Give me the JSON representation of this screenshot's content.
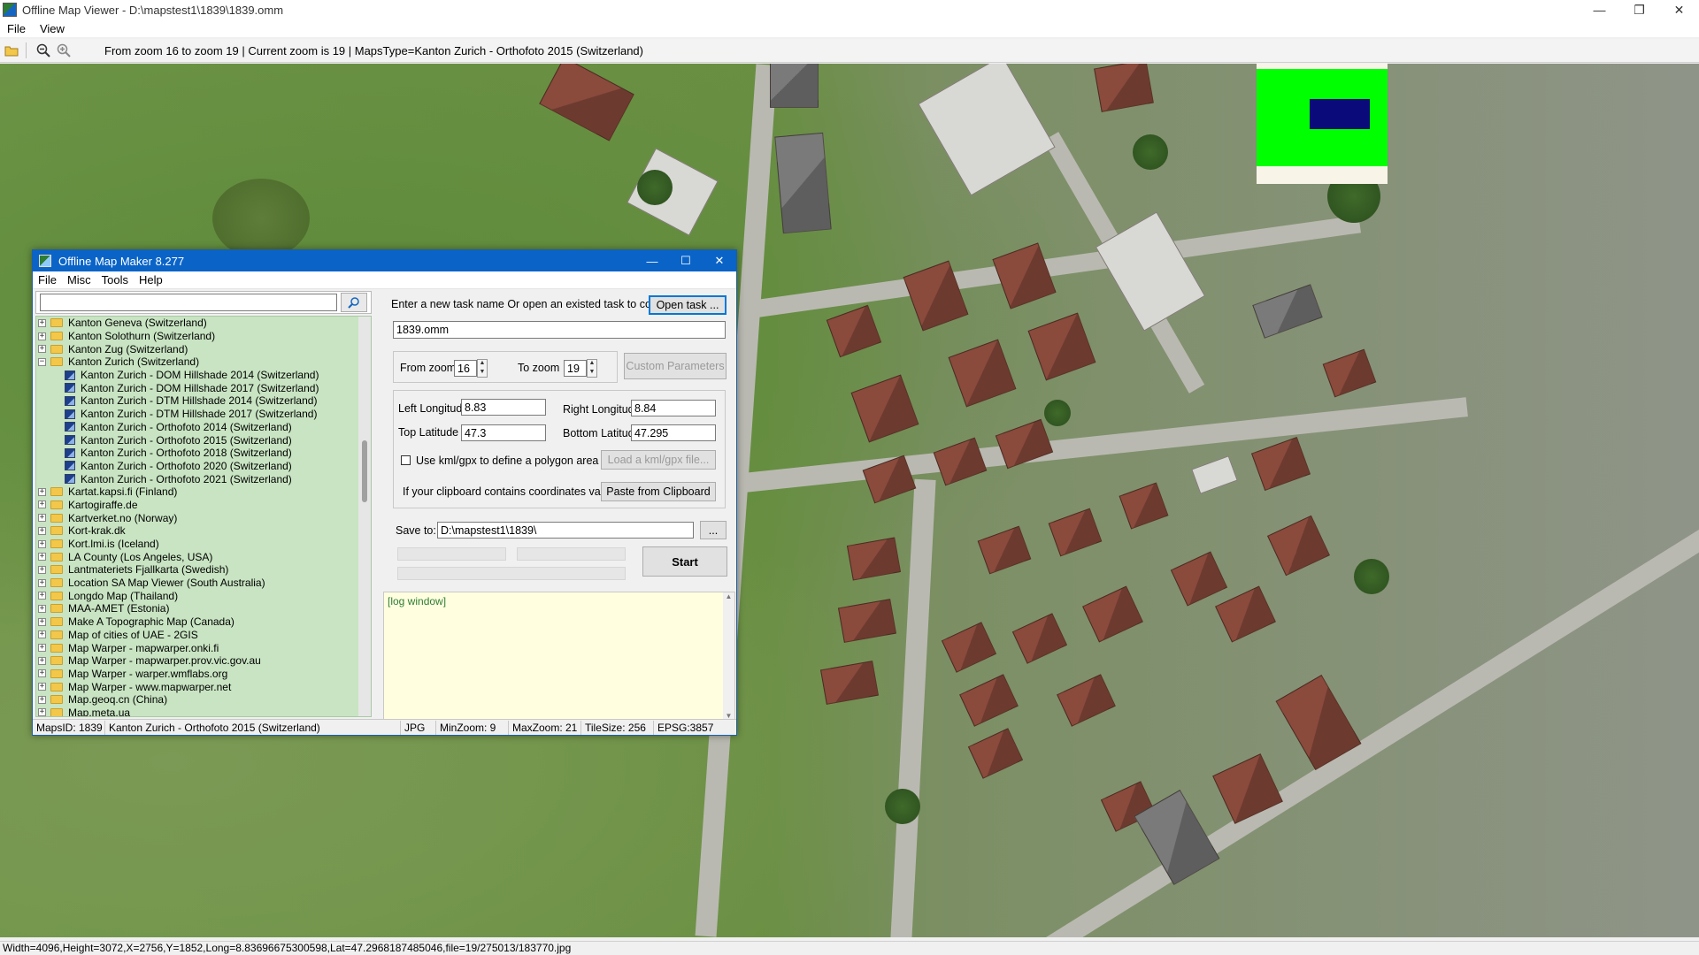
{
  "window": {
    "title": "Offline Map Viewer - D:\\mapstest1\\1839\\1839.omm",
    "controls": [
      "—",
      "❐",
      "✕"
    ]
  },
  "menu": [
    "File",
    "View"
  ],
  "toolbar": {
    "info": "From zoom 16 to zoom 19   |   Current zoom is 19 |   MapsType=Kanton Zurich - Orthofoto 2015 (Switzerland)"
  },
  "status_line": "Width=4096,Height=3072,X=2756,Y=1852,Long=8.83696675300598,Lat=47.2968187485046,file=19/275013/183770.jpg",
  "dialog": {
    "title": "Offline Map Maker 8.277",
    "controls": [
      "—",
      "☐",
      "✕"
    ],
    "menu": [
      "File",
      "Misc",
      "Tools",
      "Help"
    ],
    "search": {
      "value": ""
    },
    "tree": [
      {
        "label": "Kanton Geneva (Switzerland)",
        "type": "folder",
        "exp": "+"
      },
      {
        "label": "Kanton Solothurn (Switzerland)",
        "type": "folder",
        "exp": "+"
      },
      {
        "label": "Kanton Zug (Switzerland)",
        "type": "folder",
        "exp": "+"
      },
      {
        "label": "Kanton Zurich (Switzerland)",
        "type": "folder",
        "exp": "−"
      },
      {
        "label": "Kanton Zurich - DOM Hillshade 2014 (Switzerland)",
        "type": "map"
      },
      {
        "label": "Kanton Zurich - DOM Hillshade 2017 (Switzerland)",
        "type": "map"
      },
      {
        "label": "Kanton Zurich - DTM Hillshade 2014 (Switzerland)",
        "type": "map"
      },
      {
        "label": "Kanton Zurich - DTM Hillshade 2017 (Switzerland)",
        "type": "map"
      },
      {
        "label": "Kanton Zurich - Orthofoto 2014 (Switzerland)",
        "type": "map"
      },
      {
        "label": "Kanton Zurich - Orthofoto 2015 (Switzerland)",
        "type": "map"
      },
      {
        "label": "Kanton Zurich - Orthofoto 2018 (Switzerland)",
        "type": "map"
      },
      {
        "label": "Kanton Zurich - Orthofoto 2020 (Switzerland)",
        "type": "map"
      },
      {
        "label": "Kanton Zurich - Orthofoto 2021 (Switzerland)",
        "type": "map"
      },
      {
        "label": "Kartat.kapsi.fi (Finland)",
        "type": "folder",
        "exp": "+"
      },
      {
        "label": "Kartogiraffe.de",
        "type": "folder",
        "exp": "+"
      },
      {
        "label": "Kartverket.no (Norway)",
        "type": "folder",
        "exp": "+"
      },
      {
        "label": "Kort-krak.dk",
        "type": "folder",
        "exp": "+"
      },
      {
        "label": "Kort.lmi.is (Iceland)",
        "type": "folder",
        "exp": "+"
      },
      {
        "label": "LA County (Los Angeles, USA)",
        "type": "folder",
        "exp": "+"
      },
      {
        "label": "Lantmateriets Fjallkarta (Swedish)",
        "type": "folder",
        "exp": "+"
      },
      {
        "label": "Location SA Map Viewer (South Australia)",
        "type": "folder",
        "exp": "+"
      },
      {
        "label": "Longdo Map (Thailand)",
        "type": "folder",
        "exp": "+"
      },
      {
        "label": "MAA-AMET (Estonia)",
        "type": "folder",
        "exp": "+"
      },
      {
        "label": "Make A Topographic Map (Canada)",
        "type": "folder",
        "exp": "+"
      },
      {
        "label": "Map of cities of UAE - 2GIS",
        "type": "folder",
        "exp": "+"
      },
      {
        "label": "Map Warper - mapwarper.onki.fi",
        "type": "folder",
        "exp": "+"
      },
      {
        "label": "Map Warper - mapwarper.prov.vic.gov.au",
        "type": "folder",
        "exp": "+"
      },
      {
        "label": "Map Warper - warper.wmflabs.org",
        "type": "folder",
        "exp": "+"
      },
      {
        "label": "Map Warper - www.mapwarper.net",
        "type": "folder",
        "exp": "+"
      },
      {
        "label": "Map.geoq.cn (China)",
        "type": "folder",
        "exp": "+"
      },
      {
        "label": "Map.meta.ua",
        "type": "folder",
        "exp": "+"
      }
    ],
    "task_prompt": "Enter a new task name Or open an existed task to continue:",
    "open_task": "Open task ...",
    "task_name": "1839.omm",
    "from_zoom_label": "From zoom",
    "from_zoom": "16",
    "to_zoom_label": "To zoom",
    "to_zoom": "19",
    "custom_params": "Custom Parameters",
    "left_lon_label": "Left Longitude",
    "left_lon": "8.83",
    "right_lon_label": "Right Longitude",
    "right_lon": "8.84",
    "top_lat_label": "Top Latitude",
    "top_lat": "47.3",
    "bottom_lat_label": "Bottom Latitude",
    "bottom_lat": "47.295",
    "kml_check_label": "Use kml/gpx to define a polygon area",
    "load_kml": "Load a kml/gpx file...",
    "clipboard_label": "If your clipboard contains coordinates values:",
    "paste_clipboard": "Paste from Clipboard",
    "save_to_label": "Save to:",
    "save_to": "D:\\mapstest1\\1839\\",
    "browse": "...",
    "start": "Start",
    "log": "[log window]",
    "status": {
      "maps_id": "MapsID: 1839",
      "map_name": "Kanton Zurich - Orthofoto 2015 (Switzerland)",
      "format": "JPG",
      "min_zoom": "MinZoom: 9",
      "max_zoom": "MaxZoom: 21",
      "tile_size": "TileSize: 256",
      "epsg": "EPSG:3857"
    }
  }
}
